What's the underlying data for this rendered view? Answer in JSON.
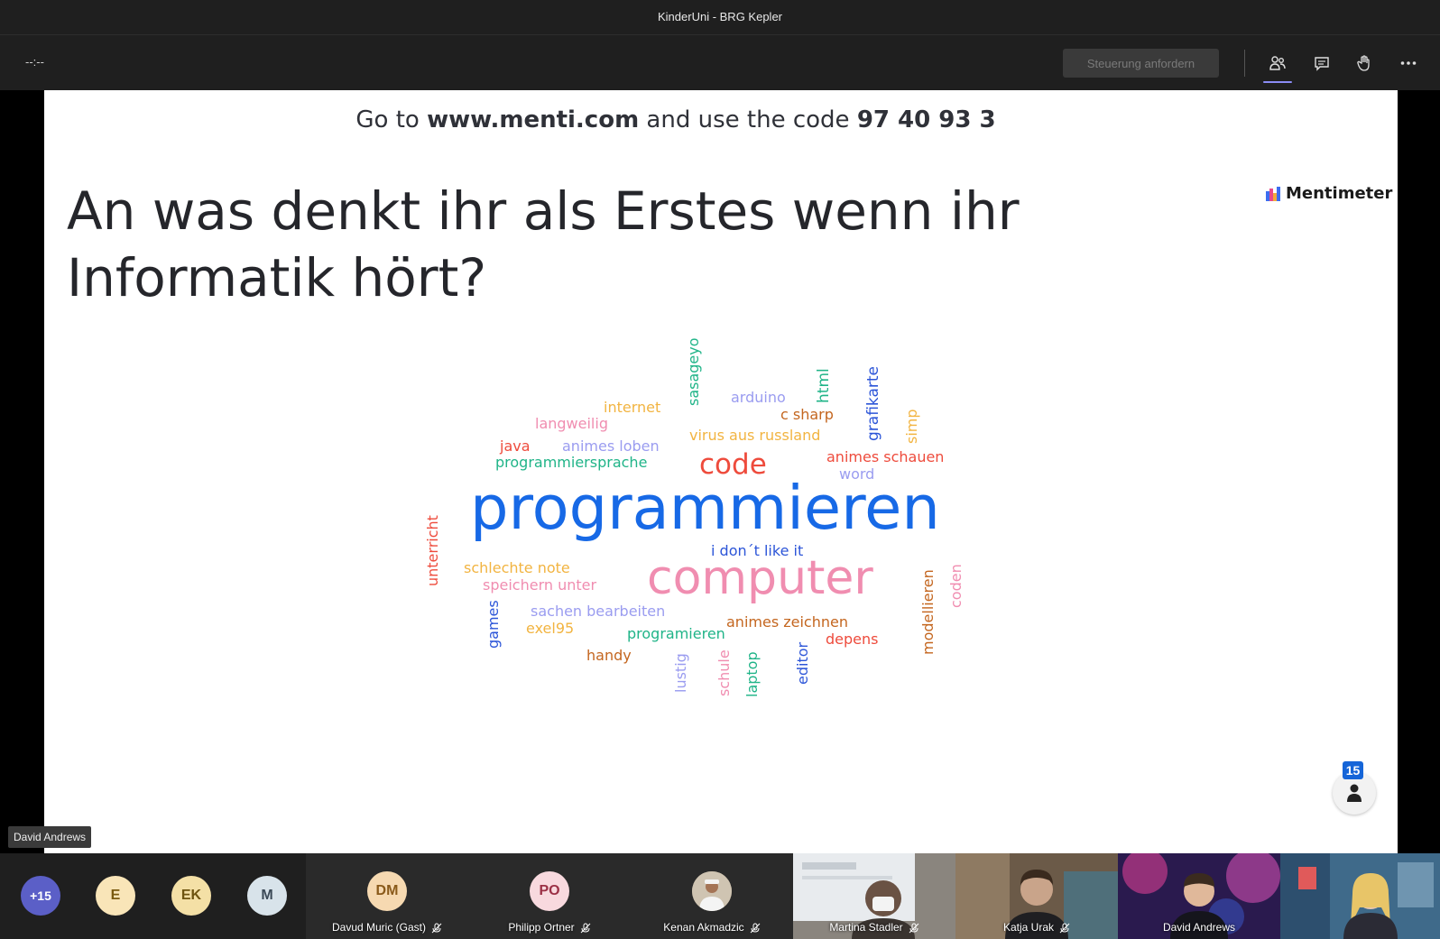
{
  "window": {
    "title": "KinderUni - BRG Kepler"
  },
  "toolbar": {
    "timer": "--:--",
    "request_control": "Steuerung anfordern",
    "icons": [
      "participants-icon",
      "chat-icon",
      "raise-hand-icon",
      "more-icon"
    ]
  },
  "slide": {
    "code_prefix": "Go to ",
    "code_url": "www.menti.com",
    "code_mid": " and use the code ",
    "code_value": "97 40 93 3",
    "brand": "Mentimeter",
    "question": "An was denkt ihr als Erstes wenn ihr Informatik hört?",
    "participant_count": "15",
    "words": [
      "programmieren",
      "computer",
      "code",
      "sasageyo",
      "arduino",
      "html",
      "grafikarte",
      "simp",
      "internet",
      "c sharp",
      "langweilig",
      "java",
      "animes loben",
      "virus aus russland",
      "programmiersprache",
      "animes schauen",
      "word",
      "unterricht",
      "i don´t like it",
      "schlechte note",
      "speichern unter",
      "coden",
      "modellieren",
      "games",
      "sachen bearbeiten",
      "exel95",
      "animes zeichnen",
      "programieren",
      "depens",
      "handy",
      "lustig",
      "schule",
      "laptop",
      "editor"
    ]
  },
  "colors": {
    "blue": "#1769e6",
    "pink": "#f08db0",
    "red": "#ee4b3c",
    "orange": "#f2b441",
    "teal": "#20b488",
    "lavender": "#9a9cf0",
    "brown": "#c4661f",
    "darkblue": "#2c55d8"
  },
  "speaker_label": "David Andrews",
  "participants": {
    "overflow": "+15",
    "avatars": [
      "E",
      "EK",
      "M"
    ],
    "tiles": [
      {
        "initials": "DM",
        "name": "Davud Muric (Gast)"
      },
      {
        "initials": "PO",
        "name": "Philipp Ortner"
      },
      {
        "name": "Kenan Akmadzic"
      },
      {
        "name": "Martina Stadler"
      },
      {
        "name": "Katja Urak"
      },
      {
        "name": "David Andrews"
      }
    ]
  }
}
